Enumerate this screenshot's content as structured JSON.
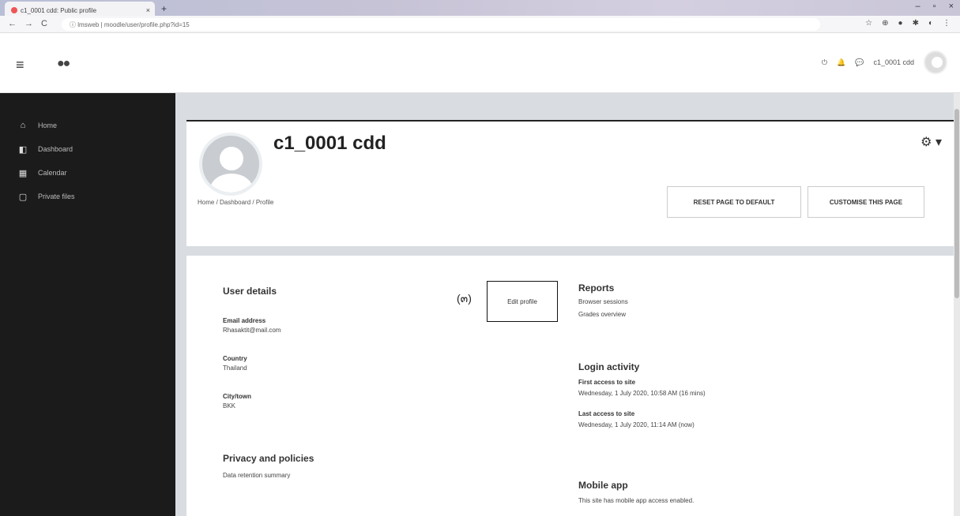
{
  "browser": {
    "tab_title": "c1_0001 cdd: Public profile",
    "tab_close": "×",
    "new_tab": "+",
    "window_controls": [
      "–",
      "▫",
      "×"
    ],
    "nav": [
      "←",
      "→",
      "C"
    ],
    "url": "ⓘ lmsweb | moodle/user/profile.php?id=15",
    "extensions": [
      "☆",
      "⊕",
      "●",
      "✱",
      "◐",
      "⋮"
    ]
  },
  "navbar": {
    "menu_icon": "≡",
    "logo_text": "●●",
    "icons": [
      "⏻",
      "🔔",
      "💬"
    ],
    "user_name": "c1_0001 cdd"
  },
  "sidebar": {
    "items": [
      {
        "icon": "⌂",
        "label": "Home"
      },
      {
        "icon": "◧",
        "label": "Dashboard"
      },
      {
        "icon": "▦",
        "label": "Calendar"
      },
      {
        "icon": "▢",
        "label": "Private files"
      }
    ]
  },
  "header": {
    "full_name": "c1_0001 cdd",
    "gear_icon": "⚙ ▾",
    "breadcrumb": "Home  /  Dashboard  /  Profile",
    "reset_button": "RESET PAGE TO DEFAULT",
    "customise_button": "CUSTOMISE THIS PAGE"
  },
  "user_details": {
    "heading": "User details",
    "email_label": "Email address",
    "email_value": "Rhasaktit@mail.com",
    "country_label": "Country",
    "country_value": "Thailand",
    "city_label": "City/town",
    "city_value": "BKK",
    "edit_profile": "Edit profile",
    "annotation": "(๓)"
  },
  "privacy": {
    "heading": "Privacy and policies",
    "link": "Data retention summary"
  },
  "reports": {
    "heading": "Reports",
    "links": [
      "Browser sessions",
      "Grades overview"
    ]
  },
  "login_activity": {
    "heading": "Login activity",
    "first_label": "First access to site",
    "first_value": "Wednesday, 1 July 2020, 10:58 AM  (16 mins)",
    "last_label": "Last access to site",
    "last_value": "Wednesday, 1 July 2020, 11:14 AM  (now)"
  },
  "mobile_app": {
    "heading": "Mobile app",
    "text": "This site has mobile app access enabled."
  }
}
